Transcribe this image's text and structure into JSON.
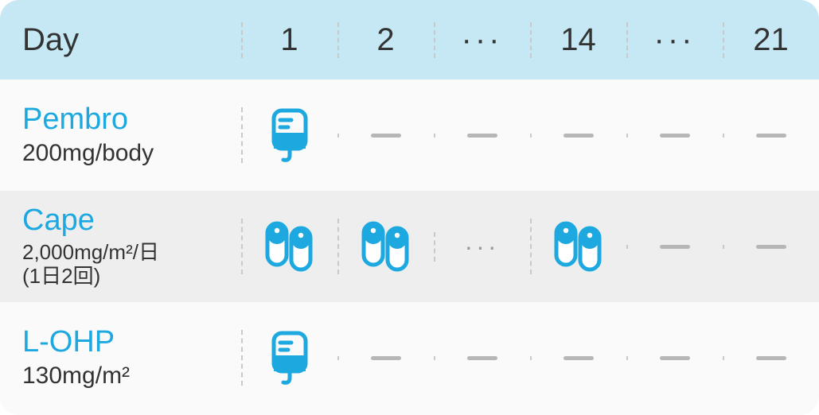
{
  "header": {
    "label": "Day",
    "columns": [
      "1",
      "2",
      "···",
      "14",
      "···",
      "21"
    ]
  },
  "drugs": [
    {
      "name": "Pembro",
      "dose": "200mg/body",
      "dose_small": false,
      "cells": [
        "iv",
        "dash",
        "dash",
        "dash",
        "dash",
        "dash"
      ]
    },
    {
      "name": "Cape",
      "dose": "2,000mg/m²/日\n(1日2回)",
      "dose_small": true,
      "cells": [
        "pill",
        "pill",
        "ellipsis",
        "pill",
        "dash",
        "dash"
      ]
    },
    {
      "name": "L-OHP",
      "dose": "130mg/m²",
      "dose_small": false,
      "cells": [
        "iv",
        "dash",
        "dash",
        "dash",
        "dash",
        "dash"
      ]
    }
  ],
  "icons": {
    "iv": "iv-bag-icon",
    "pill": "capsule-icon"
  },
  "colors": {
    "accent": "#1da9e0",
    "header_bg": "#c5e8f4"
  }
}
